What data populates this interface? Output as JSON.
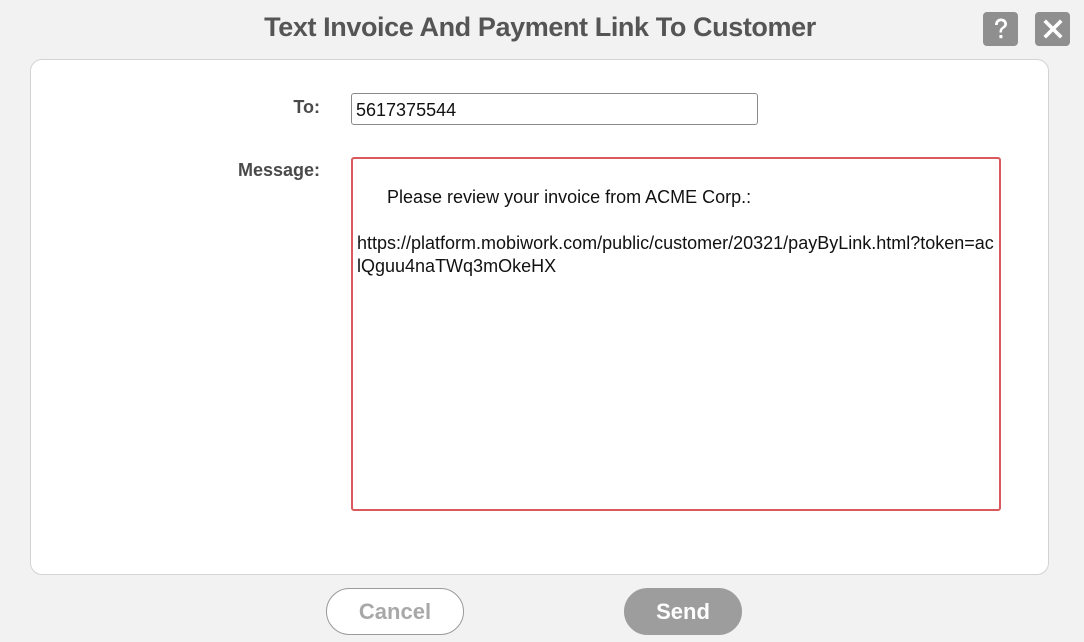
{
  "dialog": {
    "title": "Text Invoice And Payment Link To Customer"
  },
  "header_icons": {
    "help": "question-mark-icon",
    "close": "close-x-icon"
  },
  "form": {
    "to_label": "To:",
    "to_value": "5617375544",
    "message_label": "Message:",
    "message_value": "Please review your invoice from ACME Corp.:\n\nhttps://platform.mobiwork.com/public/customer/20321/payByLink.html?token=aclQguu4naTWq3mOkeHX"
  },
  "buttons": {
    "cancel": "Cancel",
    "send": "Send"
  },
  "colors": {
    "background": "#f2f2f2",
    "title": "#555555",
    "icon_button": "#8f8f8f",
    "message_border": "#d9595c",
    "send_button": "#9d9d9d",
    "cancel_text": "#a8a8a8"
  }
}
